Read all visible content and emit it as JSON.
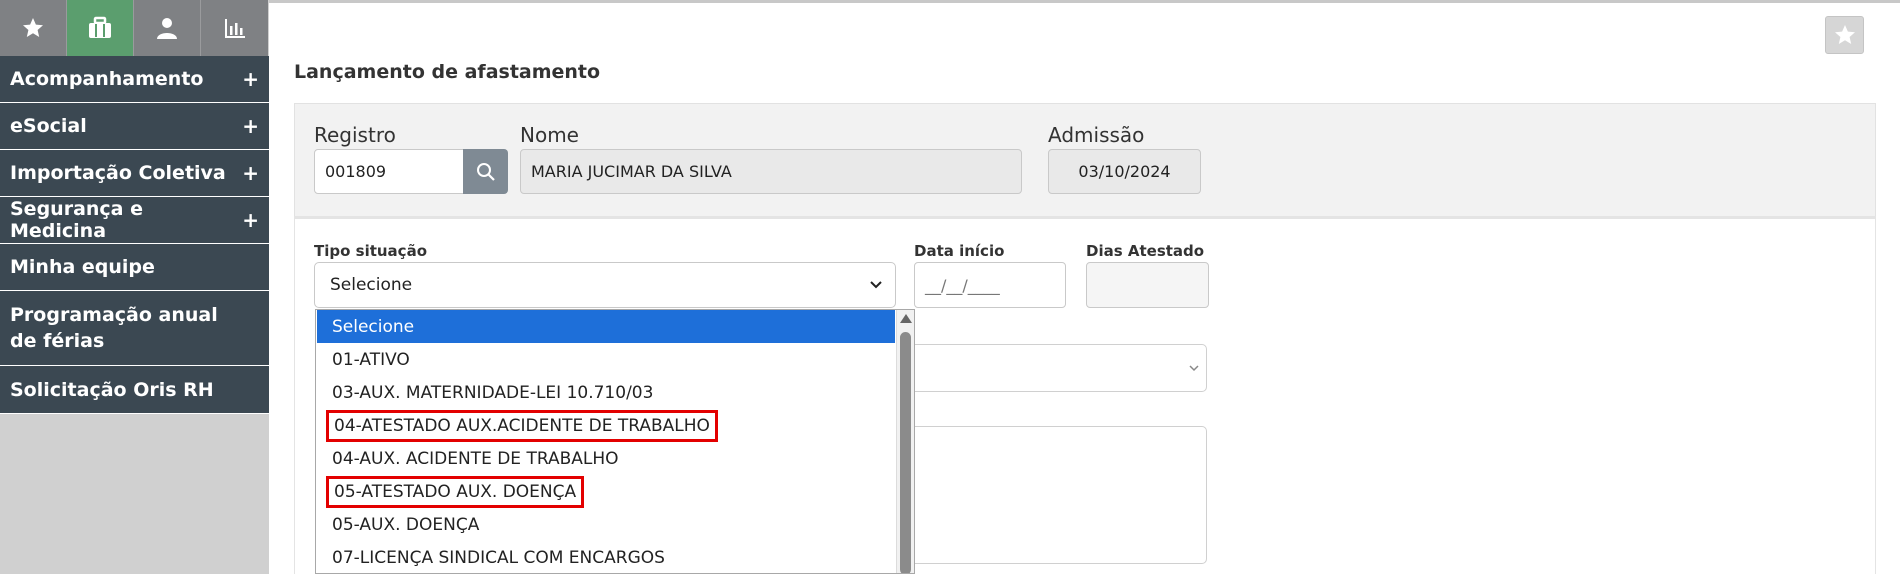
{
  "sidebar": {
    "icon_tabs": [
      {
        "icon": "star-icon"
      },
      {
        "icon": "briefcase-icon"
      },
      {
        "icon": "user-icon"
      },
      {
        "icon": "bar-chart-icon"
      }
    ],
    "menu": [
      {
        "label": "Acompanhamento",
        "expand": "+"
      },
      {
        "label": "eSocial",
        "expand": "+"
      },
      {
        "label": "Importação Coletiva",
        "expand": "+"
      },
      {
        "label": "Segurança e Medicina",
        "expand": "+"
      },
      {
        "label": "Minha equipe"
      },
      {
        "label": "Programação anual de férias"
      },
      {
        "label": "Solicitação Oris RH"
      }
    ]
  },
  "page": {
    "title": "Lançamento de afastamento",
    "favorite_icon": "star-icon"
  },
  "employee": {
    "registro_label": "Registro",
    "registro_value": "001809",
    "nome_label": "Nome",
    "nome_value": "MARIA JUCIMAR DA SILVA",
    "admissao_label": "Admissão",
    "admissao_value": "03/10/2024"
  },
  "form": {
    "tipo_situacao_label": "Tipo situação",
    "tipo_situacao_value": "Selecione",
    "data_inicio_label": "Data início",
    "data_inicio_placeholder": "__/__/____",
    "dias_atestado_label": "Dias Atestado"
  },
  "dropdown": {
    "options": [
      "Selecione",
      "01-ATIVO",
      "03-AUX. MATERNIDADE-LEI 10.710/03",
      "04-ATESTADO AUX.ACIDENTE DE TRABALHO",
      "04-AUX. ACIDENTE DE TRABALHO",
      "05-ATESTADO AUX. DOENÇA",
      "05-AUX. DOENÇA",
      "07-LICENÇA SINDICAL COM ENCARGOS"
    ],
    "selected_index": 0,
    "highlight_color": "#e30000",
    "selected_color": "#1e6fd9"
  },
  "colors": {
    "sidebar_menu": "#3b4852",
    "active_tab": "#5b9e6e",
    "inactive_tab": "#7f8184"
  }
}
